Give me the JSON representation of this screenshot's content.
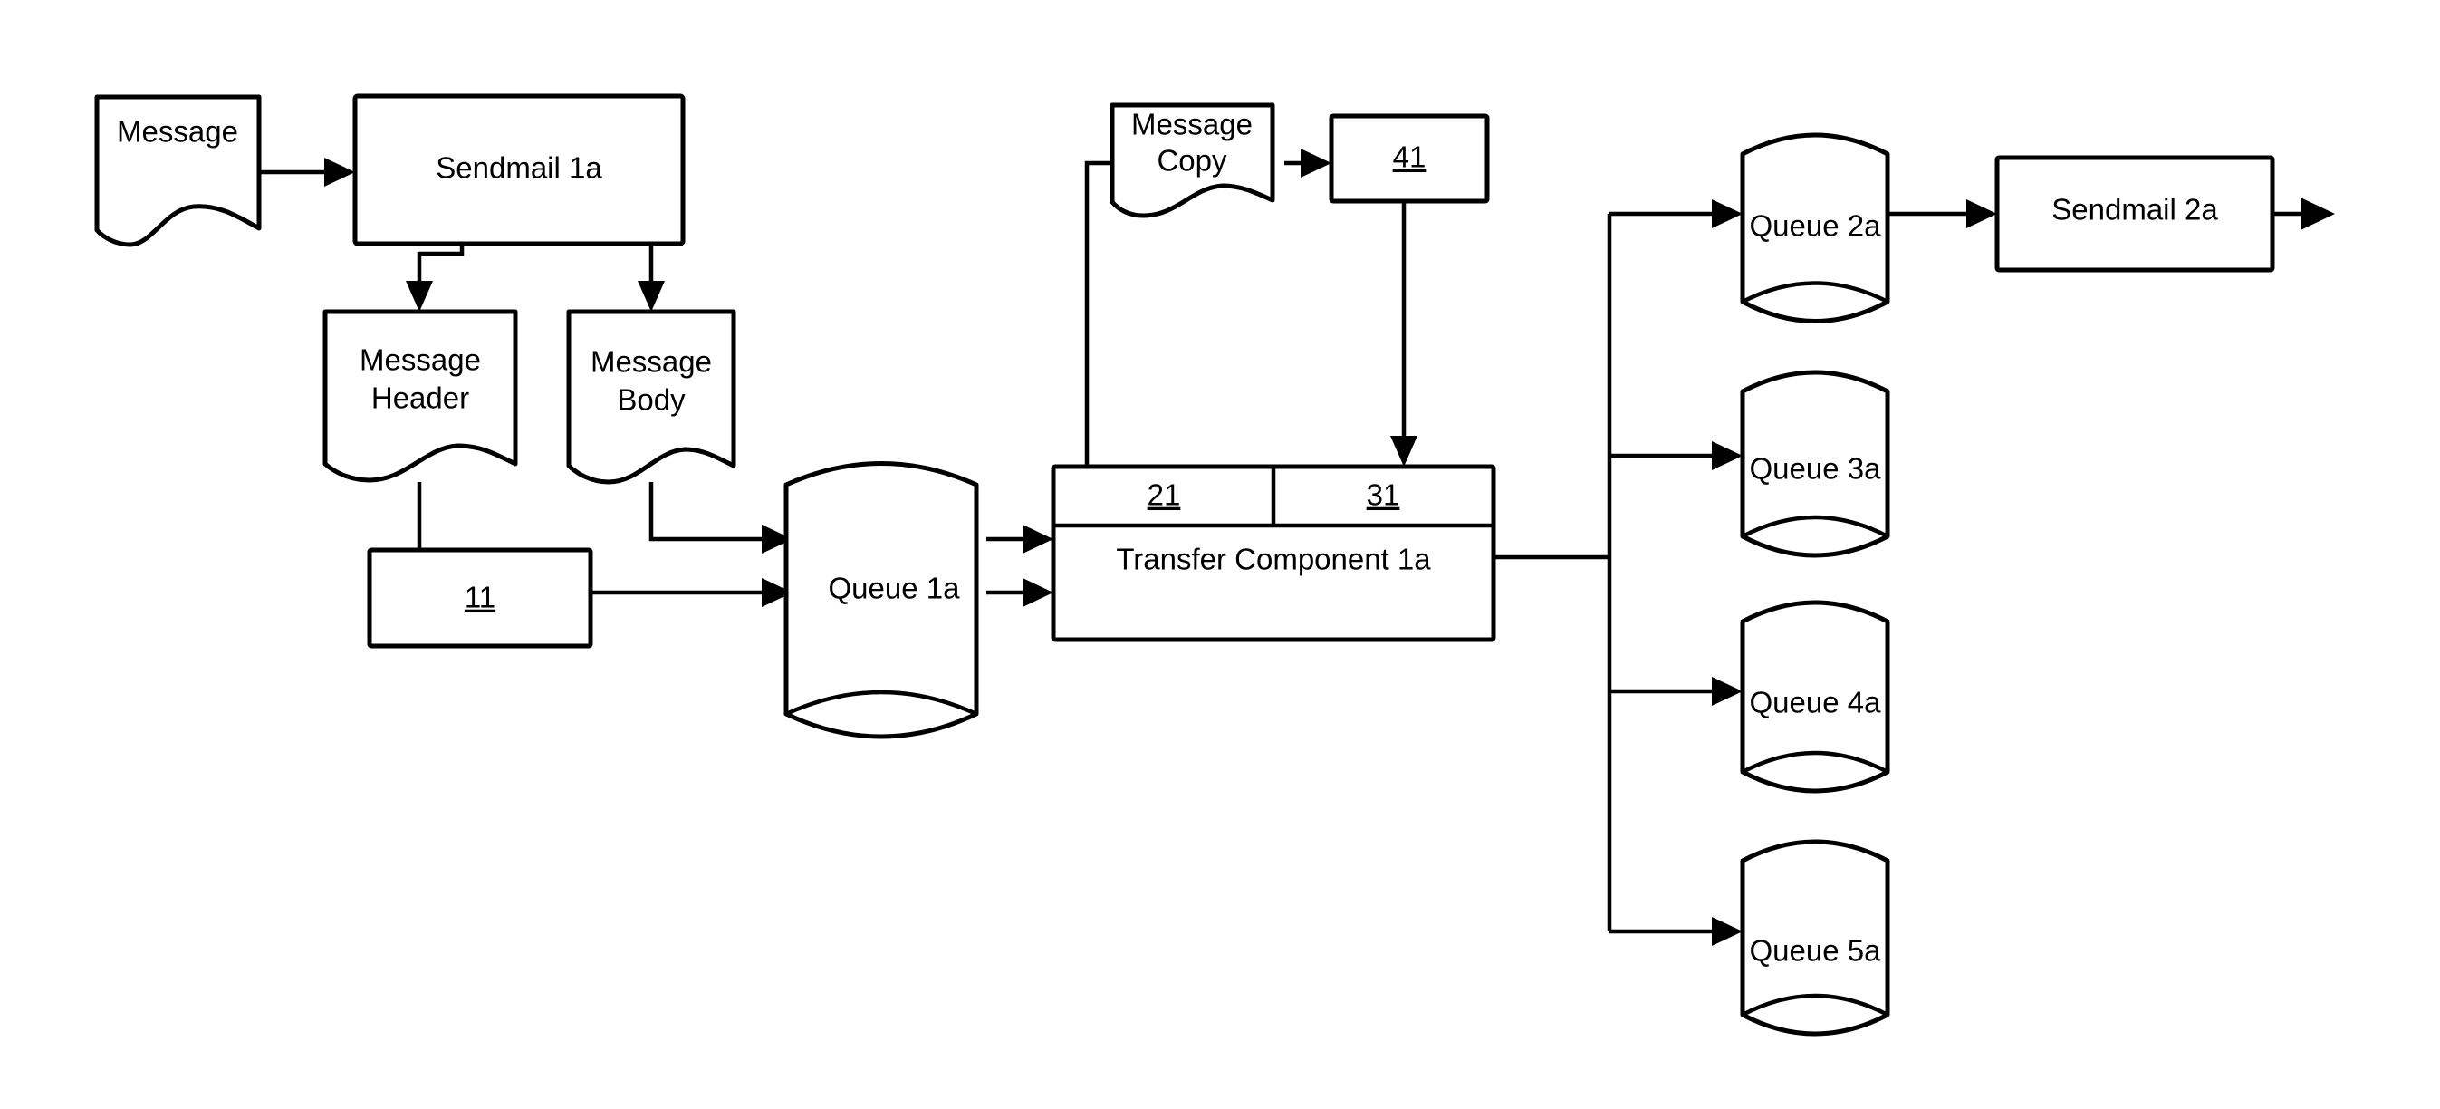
{
  "diagram": {
    "type": "flowchart",
    "colors": {
      "stroke": "#000000",
      "fill": "#ffffff",
      "text": "#000000"
    },
    "nodes": {
      "message": {
        "label_lines": [
          "Message"
        ],
        "shape": "document"
      },
      "sendmail_1a": {
        "label_lines": [
          "Sendmail 1a"
        ],
        "shape": "process"
      },
      "message_header": {
        "label_lines": [
          "Message",
          "Header"
        ],
        "shape": "document"
      },
      "message_body": {
        "label_lines": [
          "Message",
          "Body"
        ],
        "shape": "document"
      },
      "box_11": {
        "label_lines": [
          "11"
        ],
        "shape": "process",
        "underlined": true
      },
      "queue_1a": {
        "label_lines": [
          "Queue 1a"
        ],
        "shape": "cylinder"
      },
      "message_copy": {
        "label_lines": [
          "Message",
          "Copy"
        ],
        "shape": "document"
      },
      "box_41": {
        "label_lines": [
          "41"
        ],
        "shape": "process",
        "underlined": true
      },
      "box_21": {
        "label_lines": [
          "21"
        ],
        "shape": "process",
        "underlined": true
      },
      "box_31": {
        "label_lines": [
          "31"
        ],
        "shape": "process",
        "underlined": true
      },
      "transfer_component_1a": {
        "label_lines": [
          "Transfer Component 1a"
        ],
        "shape": "process"
      },
      "queue_2a": {
        "label_lines": [
          "Queue 2a"
        ],
        "shape": "cylinder"
      },
      "queue_3a": {
        "label_lines": [
          "Queue 3a"
        ],
        "shape": "cylinder"
      },
      "queue_4a": {
        "label_lines": [
          "Queue 4a"
        ],
        "shape": "cylinder"
      },
      "queue_5a": {
        "label_lines": [
          "Queue 5a"
        ],
        "shape": "cylinder"
      },
      "sendmail_2a": {
        "label_lines": [
          "Sendmail 2a"
        ],
        "shape": "process"
      }
    },
    "edges": [
      {
        "from": "message",
        "to": "sendmail_1a",
        "arrow": true
      },
      {
        "from": "sendmail_1a",
        "to": "message_header",
        "arrow": true
      },
      {
        "from": "sendmail_1a",
        "to": "message_body",
        "arrow": true
      },
      {
        "from": "message_header",
        "to": "box_11",
        "arrow": false
      },
      {
        "from": "message_body",
        "to": "queue_1a",
        "arrow": true
      },
      {
        "from": "box_11",
        "to": "queue_1a",
        "arrow": true
      },
      {
        "from": "queue_1a",
        "to": "transfer_component_1a",
        "arrow": true
      },
      {
        "from": "queue_1a",
        "to": "transfer_component_1a",
        "arrow": true
      },
      {
        "from": "box_21",
        "to": "message_copy",
        "arrow": false
      },
      {
        "from": "message_copy",
        "to": "box_41",
        "arrow": true
      },
      {
        "from": "box_41",
        "to": "box_31",
        "arrow": true
      },
      {
        "from": "transfer_component_1a",
        "to": "queue_2a",
        "arrow": true
      },
      {
        "from": "transfer_component_1a",
        "to": "queue_3a",
        "arrow": true
      },
      {
        "from": "transfer_component_1a",
        "to": "queue_4a",
        "arrow": true
      },
      {
        "from": "transfer_component_1a",
        "to": "queue_5a",
        "arrow": true
      },
      {
        "from": "queue_2a",
        "to": "sendmail_2a",
        "arrow": true
      },
      {
        "from": "sendmail_2a",
        "to": "output",
        "arrow": true
      }
    ]
  }
}
